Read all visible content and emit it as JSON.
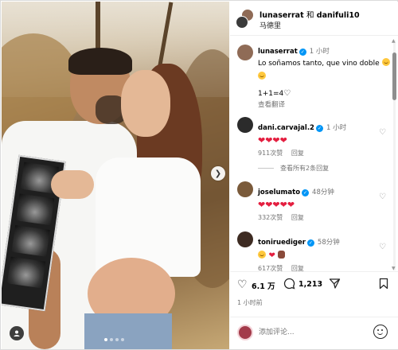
{
  "header": {
    "user1": "lunaserrat",
    "conjunction": "和",
    "user2": "danifuli10",
    "location": "马德里"
  },
  "caption": {
    "username": "lunaserrat",
    "time": "1 小时",
    "text": "Lo soñamos tanto, que vino doble",
    "equation": "1+1=4",
    "translate": "查看翻译"
  },
  "comments": [
    {
      "username": "dani.carvajal.2",
      "time": "1 小时",
      "hearts": "❤❤❤❤",
      "likes": "911次赞",
      "reply": "回复"
    },
    {
      "username": "joselumato",
      "time": "48分钟",
      "hearts": "❤❤❤❤❤",
      "likes": "332次赞",
      "reply": "回复"
    },
    {
      "username": "toniruediger",
      "time": "58分钟",
      "hearts": "❤",
      "likes": "617次赞",
      "reply": "回复"
    }
  ],
  "more_replies": "查看所有2条回复",
  "stats": {
    "likes": "6.1 万",
    "comments": "1,213",
    "posted": "1 小时前"
  },
  "composer": {
    "placeholder": "添加评论..."
  },
  "colors": {
    "verified": "#0095f6",
    "heart": "#e41e3f",
    "muted": "#737373"
  }
}
